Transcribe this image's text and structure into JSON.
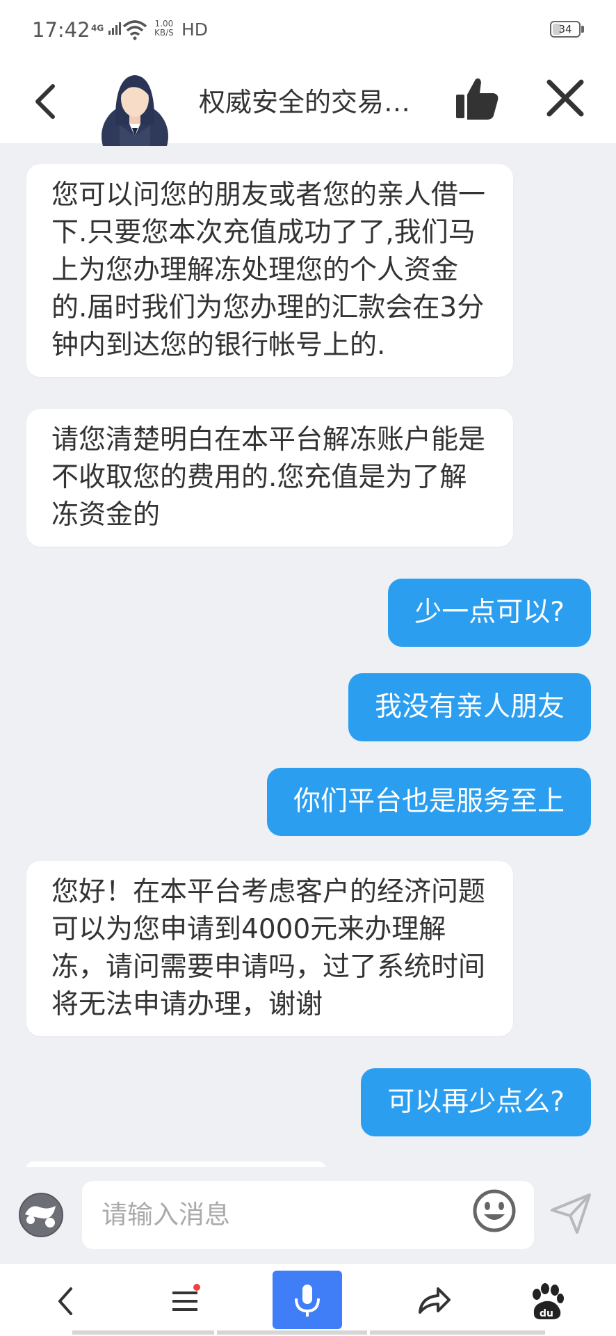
{
  "status_bar": {
    "time": "17:42",
    "network": "4G",
    "speed": "1.00\nKB/S",
    "hd": "HD",
    "battery": "34",
    "battery_level": 0.34
  },
  "header": {
    "title": "权威安全的交易…"
  },
  "messages": [
    {
      "direction": "in",
      "text": "您可以问您的朋友或者您的亲人借一下.只要您本次充值成功了了,我们马上为您办理解冻处理您的个人资金的.届时我们为您办理的汇款会在3分钟内到达您的银行帐号上的."
    },
    {
      "direction": "in",
      "text": "请您清楚明白在本平台解冻账户能是不收取您的费用的.您充值是为了解冻资金的"
    },
    {
      "direction": "out",
      "text": "少一点可以?"
    },
    {
      "direction": "out",
      "text": "我没有亲人朋友"
    },
    {
      "direction": "out",
      "text": "你们平台也是服务至上"
    },
    {
      "direction": "in",
      "text": "您好！在本平台考虑客户的经济问题可以为您申请到4000元来办理解冻，请问需要申请吗，过了系统时间将无法申请办理，谢谢"
    },
    {
      "direction": "out",
      "text": "可以再少点么?"
    }
  ],
  "input": {
    "placeholder": "请输入消息"
  },
  "colors": {
    "outgoing_bubble": "#2b9ef0",
    "incoming_bubble": "#ffffff",
    "background": "#eef0f3",
    "voice_button": "#3f7ef6"
  },
  "icons": {
    "header": [
      "back-icon",
      "avatar",
      "thumbs-up-icon",
      "close-icon"
    ],
    "input": [
      "tool-icon",
      "emoji-icon",
      "send-icon"
    ],
    "nav": [
      "back-icon",
      "menu-icon",
      "microphone-icon",
      "share-icon",
      "baidu-paw-icon"
    ]
  }
}
